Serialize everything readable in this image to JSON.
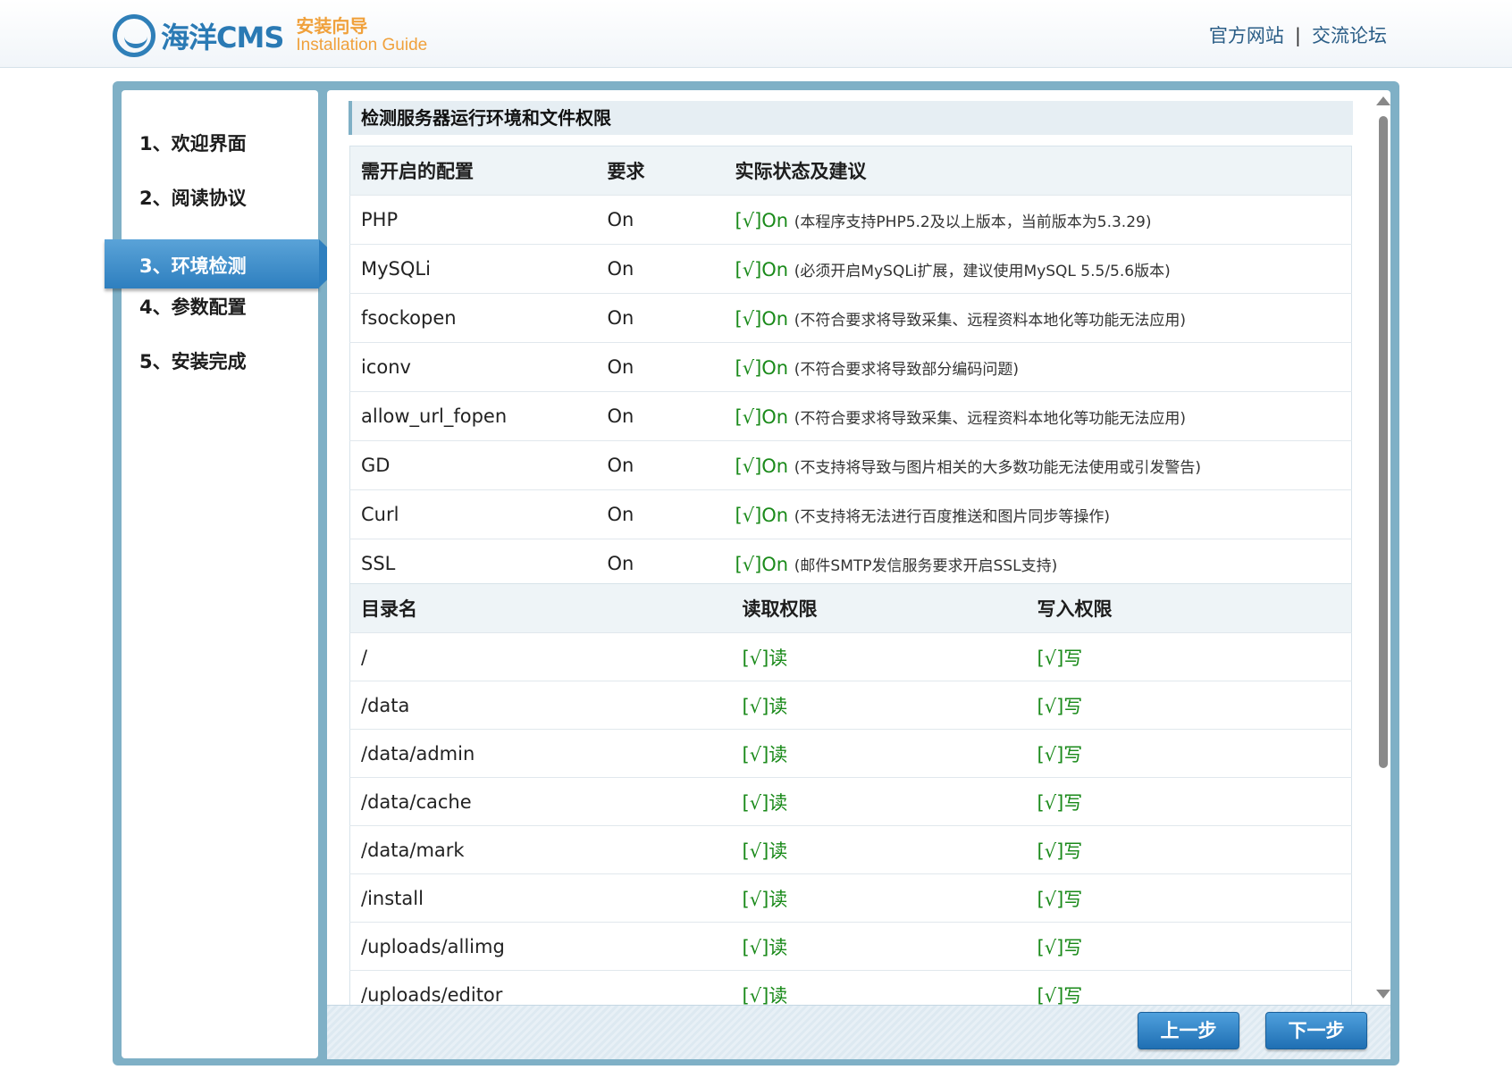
{
  "header": {
    "logo_name": "海洋CMS",
    "guide_cn": "安装向导",
    "guide_en": "Installation Guide",
    "link_official": "官方网站",
    "separator": "|",
    "link_forum": "交流论坛"
  },
  "steps": [
    {
      "label": "1、欢迎界面"
    },
    {
      "label": "2、阅读协议"
    },
    {
      "label": "3、环境检测",
      "active": true
    },
    {
      "label": "4、参数配置"
    },
    {
      "label": "5、安装完成"
    }
  ],
  "section_title": "检测服务器运行环境和文件权限",
  "env_table": {
    "headers": [
      "需开启的配置",
      "要求",
      "实际状态及建议"
    ],
    "rows": [
      {
        "name": "PHP",
        "req": "On",
        "status": "[√]On",
        "note": "(本程序支持PHP5.2及以上版本，当前版本为5.3.29)"
      },
      {
        "name": "MySQLi",
        "req": "On",
        "status": "[√]On",
        "note": "(必须开启MySQLi扩展，建议使用MySQL 5.5/5.6版本)"
      },
      {
        "name": "fsockopen",
        "req": "On",
        "status": "[√]On",
        "note": "(不符合要求将导致采集、远程资料本地化等功能无法应用)"
      },
      {
        "name": "iconv",
        "req": "On",
        "status": "[√]On",
        "note": "(不符合要求将导致部分编码问题)"
      },
      {
        "name": "allow_url_fopen",
        "req": "On",
        "status": "[√]On",
        "note": "(不符合要求将导致采集、远程资料本地化等功能无法应用)"
      },
      {
        "name": "GD",
        "req": "On",
        "status": "[√]On",
        "note": "(不支持将导致与图片相关的大多数功能无法使用或引发警告)"
      },
      {
        "name": "Curl",
        "req": "On",
        "status": "[√]On",
        "note": "(不支持将无法进行百度推送和图片同步等操作)"
      },
      {
        "name": "SSL",
        "req": "On",
        "status": "[√]On",
        "note": "(邮件SMTP发信服务要求开启SSL支持)"
      }
    ]
  },
  "perm_table": {
    "headers": [
      "目录名",
      "读取权限",
      "写入权限"
    ],
    "rows": [
      {
        "dir": "/",
        "read": "[√]读",
        "write": "[√]写"
      },
      {
        "dir": "/data",
        "read": "[√]读",
        "write": "[√]写"
      },
      {
        "dir": "/data/admin",
        "read": "[√]读",
        "write": "[√]写"
      },
      {
        "dir": "/data/cache",
        "read": "[√]读",
        "write": "[√]写"
      },
      {
        "dir": "/data/mark",
        "read": "[√]读",
        "write": "[√]写"
      },
      {
        "dir": "/install",
        "read": "[√]读",
        "write": "[√]写"
      },
      {
        "dir": "/uploads/allimg",
        "read": "[√]读",
        "write": "[√]写"
      },
      {
        "dir": "/uploads/editor",
        "read": "[√]读",
        "write": "[√]写"
      }
    ]
  },
  "buttons": {
    "prev": "上一步",
    "next": "下一步"
  },
  "colors": {
    "accent": "#2e7fbf",
    "ok": "#1a8a1a",
    "frame": "#7fb0c6"
  }
}
